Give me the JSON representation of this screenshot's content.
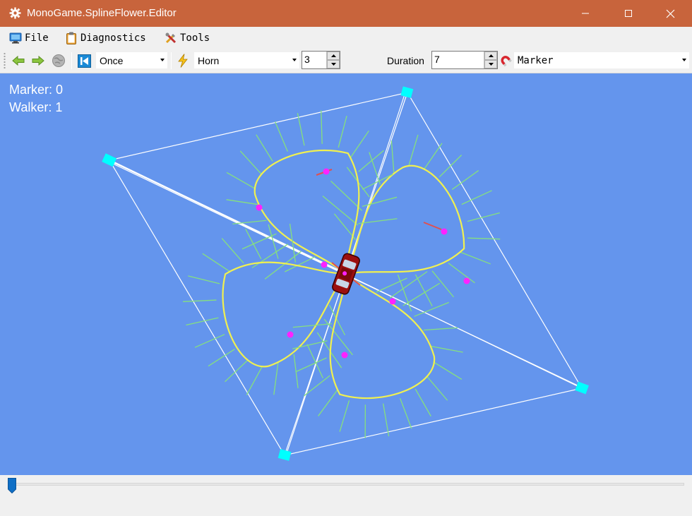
{
  "window": {
    "title": "MonoGame.SplineFlower.Editor",
    "titlebar_color": "#c8643c"
  },
  "menu": {
    "items": [
      {
        "label": "File",
        "icon": "monitor-icon"
      },
      {
        "label": "Diagnostics",
        "icon": "clipboard-icon"
      },
      {
        "label": "Tools",
        "icon": "tools-icon"
      }
    ]
  },
  "toolbar": {
    "loop_mode": "Once",
    "trigger_type": "Horn",
    "trigger_count": "3",
    "duration_label": "Duration",
    "duration_value": "7",
    "tool_mode": "Marker"
  },
  "viewport": {
    "background": "#6495ed",
    "hud": {
      "marker_line": "Marker: 0",
      "walker_line": "Walker: 1"
    }
  },
  "timeline": {
    "progress": 0.0
  }
}
